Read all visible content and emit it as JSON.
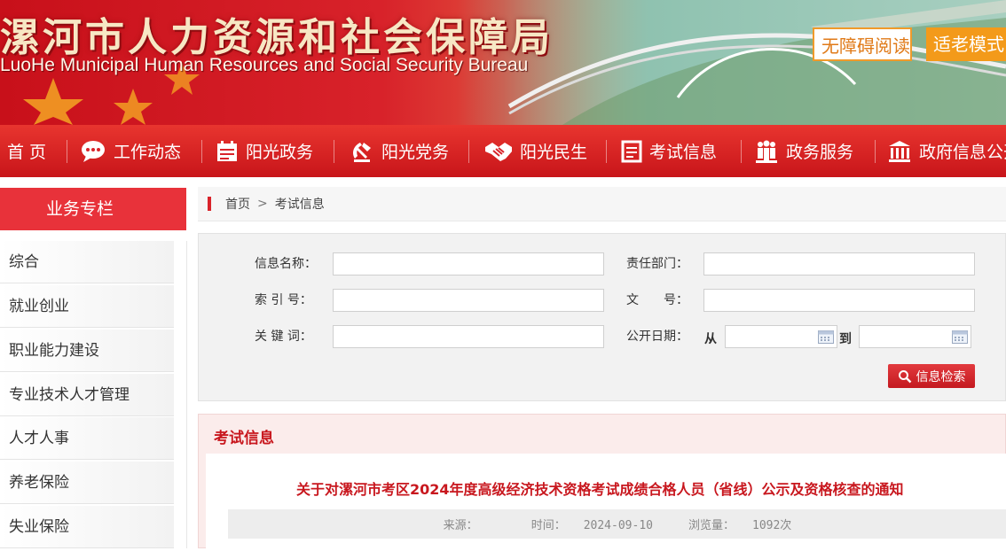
{
  "banner": {
    "title": "漯河市人力资源和社会保障局",
    "subtitle": "LuoHe Municipal Human Resources and Social Security Bureau",
    "accessibility_label": "无障碍阅读",
    "elder_mode_label": "适老模式"
  },
  "nav": {
    "items": [
      {
        "label": "首 页",
        "icon": "home"
      },
      {
        "label": "工作动态",
        "icon": "chat-bubble-icon"
      },
      {
        "label": "阳光政务",
        "icon": "calendar-icon"
      },
      {
        "label": "阳光党务",
        "icon": "party-emblem-icon"
      },
      {
        "label": "阳光民生",
        "icon": "handshake-icon"
      },
      {
        "label": "考试信息",
        "icon": "document-icon"
      },
      {
        "label": "政务服务",
        "icon": "people-icon"
      },
      {
        "label": "政府信息公开",
        "icon": "government-building-icon"
      }
    ]
  },
  "sidebar": {
    "title": "业务专栏",
    "items": [
      {
        "label": "综合"
      },
      {
        "label": "就业创业"
      },
      {
        "label": "职业能力建设"
      },
      {
        "label": "专业技术人才管理"
      },
      {
        "label": "人才人事"
      },
      {
        "label": "养老保险"
      },
      {
        "label": "失业保险"
      }
    ]
  },
  "breadcrumb": {
    "home": "首页",
    "separator": ">",
    "current": "考试信息"
  },
  "search": {
    "info_name_label": "信息名称：",
    "info_name_value": "",
    "department_label": "责任部门：",
    "department_value": "",
    "index_label": "索 引 号：",
    "index_value": "",
    "doc_number_label": "文　　号：",
    "doc_number_value": "",
    "keyword_label": "关 键 词：",
    "keyword_value": "",
    "date_label": "公开日期：",
    "date_from_label": "从",
    "date_to_label": "到",
    "date_from_value": "",
    "date_to_value": "",
    "button_label": "信息检索"
  },
  "exam": {
    "section_title": "考试信息",
    "article_title": "关于对漯河市考区2024年度高级经济技术资格考试成绩合格人员（省线）公示及资格核查的通知",
    "source_label": "来源：",
    "source_value": "",
    "time_label": "时间：",
    "time_value": "2024-09-10",
    "views_label": "浏览量：",
    "views_value": "1092次"
  },
  "colors": {
    "primary_red": "#d9232a",
    "nav_red": "#e8352f",
    "accent_orange": "#f39a1a",
    "title_red": "#c8171e"
  }
}
